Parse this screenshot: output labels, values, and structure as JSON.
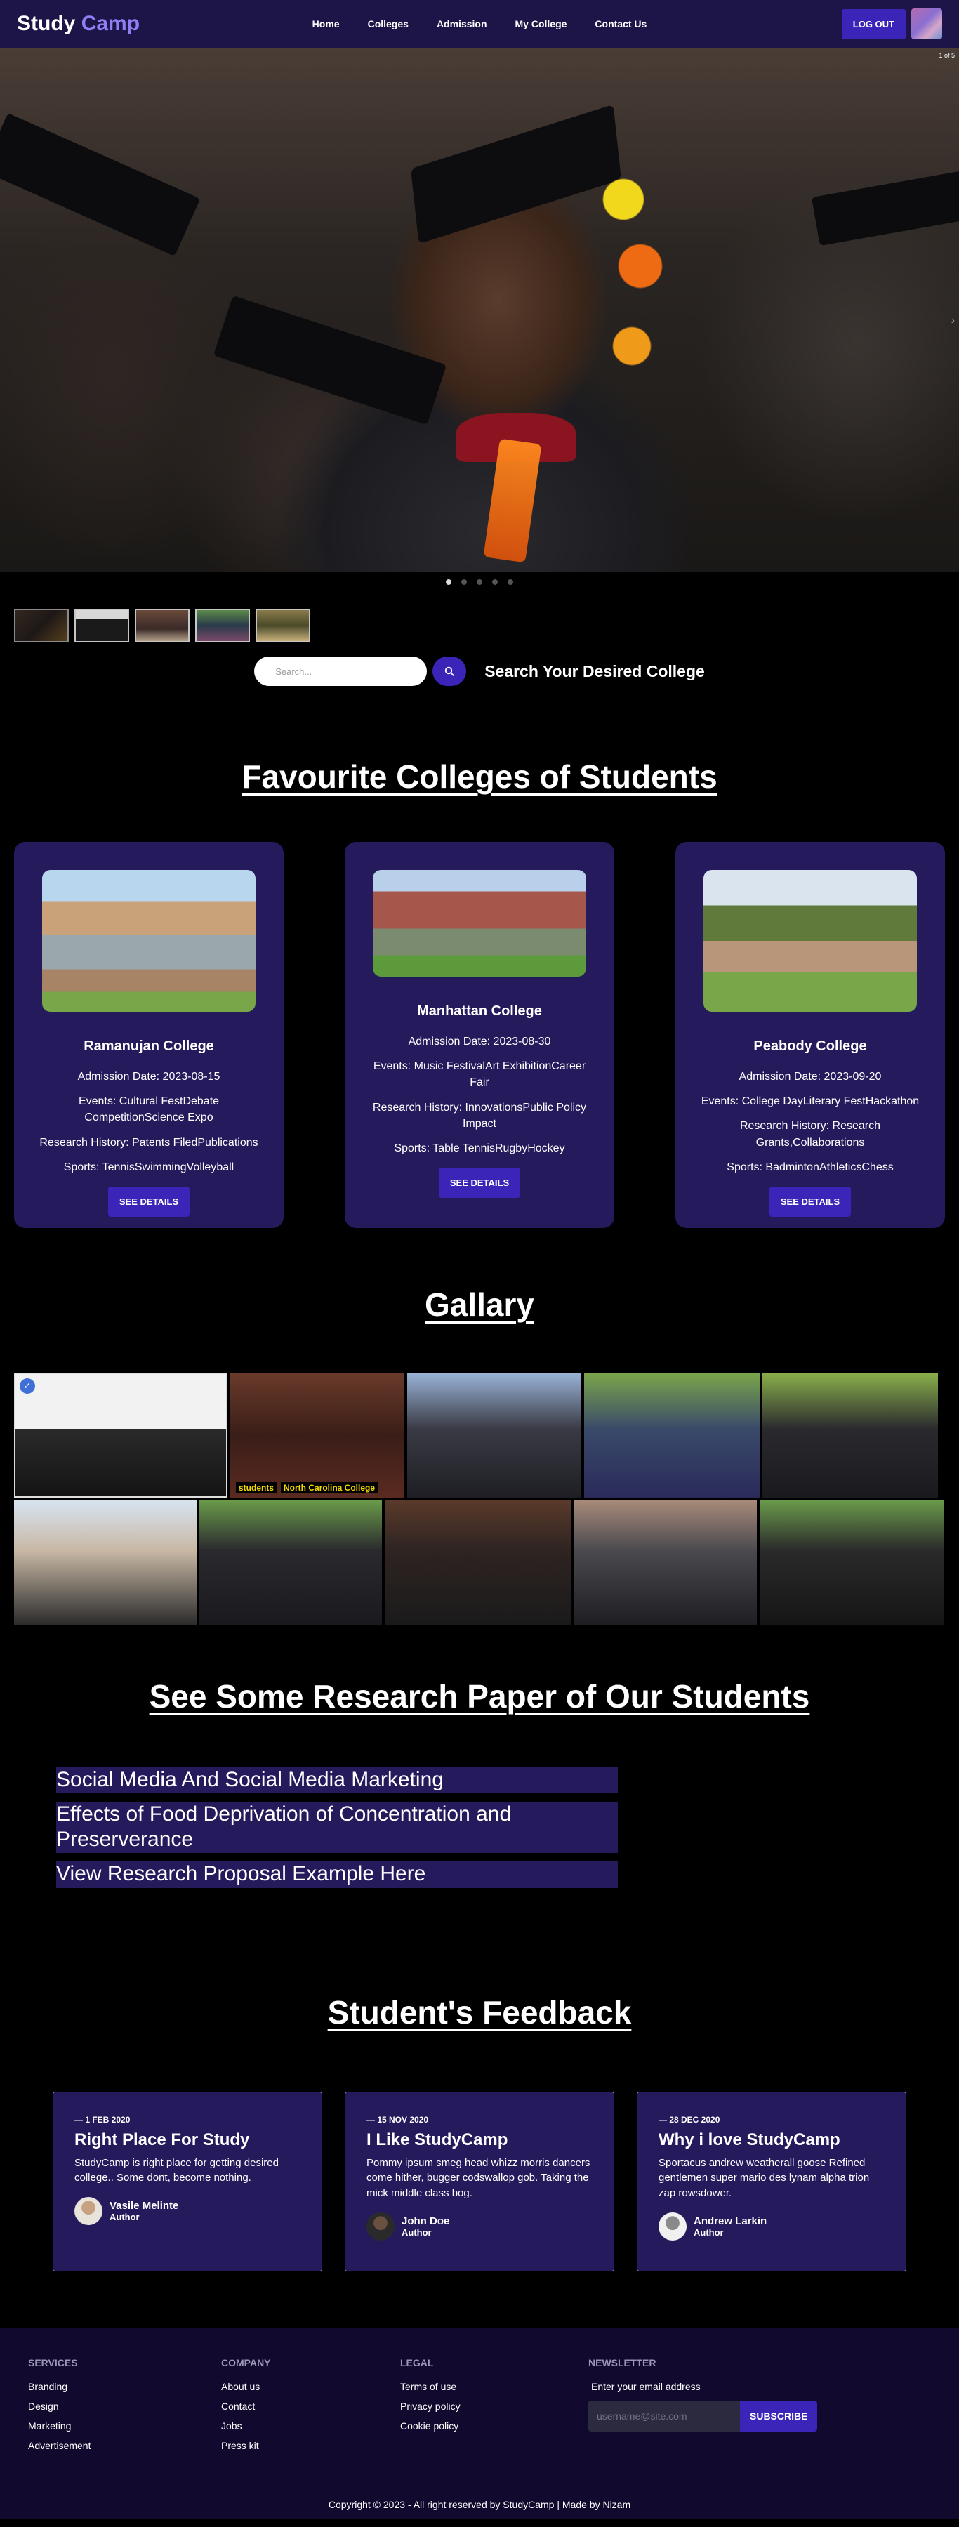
{
  "nav": {
    "brand_main": "Study",
    "brand_accent": "Camp",
    "links": [
      "Home",
      "Colleges",
      "Admission",
      "My College",
      "Contact Us"
    ],
    "logout": "LOG OUT"
  },
  "hero": {
    "counter": "1 of 5",
    "active_slide": 1,
    "slide_count": 5
  },
  "search": {
    "placeholder": "Search...",
    "heading": "Search Your Desired College"
  },
  "colleges_section": {
    "title": "Favourite Colleges of Students",
    "details_label": "SEE DETAILS",
    "items": [
      {
        "name": "Ramanujan College",
        "admission": "Admission Date: 2023-08-15",
        "events": "Events: Cultural FestDebate CompetitionScience Expo",
        "research": "Research History: Patents FiledPublications",
        "sports": "Sports: TennisSwimmingVolleyball"
      },
      {
        "name": "Manhattan College",
        "admission": "Admission Date: 2023-08-30",
        "events": "Events: Music FestivalArt ExhibitionCareer Fair",
        "research": "Research History: InnovationsPublic Policy Impact",
        "sports": "Sports: Table TennisRugbyHockey"
      },
      {
        "name": "Peabody College",
        "admission": "Admission Date: 2023-09-20",
        "events": "Events: College DayLiterary FestHackathon",
        "research": "Research History: Research Grants,Collaborations",
        "sports": "Sports: BadmintonAthleticsChess"
      }
    ]
  },
  "gallery": {
    "title": "Gallary",
    "banner_left": "students",
    "banner_right": "North Carolina College"
  },
  "papers": {
    "title": "See Some Research Paper of Our Students",
    "items": [
      "Social Media And Social Media Marketing",
      "Effects of Food Deprivation of Concentration and Preserverance",
      "View Research Proposal Example Here"
    ]
  },
  "feedback": {
    "title": "Student's Feedback",
    "items": [
      {
        "date": "— 1 FEB 2020",
        "title": "Right Place For Study",
        "text": "StudyCamp is right place for getting desired college.. Some dont, become nothing.",
        "name": "Vasile Melinte",
        "role": "Author"
      },
      {
        "date": "— 15 NOV 2020",
        "title": "I Like StudyCamp",
        "text": "Pommy ipsum smeg head whizz morris dancers come hither, bugger codswallop gob. Taking the mick middle class bog.",
        "name": "John Doe",
        "role": "Author"
      },
      {
        "date": "— 28 DEC 2020",
        "title": "Why i love StudyCamp",
        "text": "Sportacus andrew weatherall goose Refined gentlemen super mario des lynam alpha trion zap rowsdower.",
        "name": "Andrew Larkin",
        "role": "Author"
      }
    ]
  },
  "footer": {
    "services": {
      "heading": "SERVICES",
      "links": [
        "Branding",
        "Design",
        "Marketing",
        "Advertisement"
      ]
    },
    "company": {
      "heading": "COMPANY",
      "links": [
        "About us",
        "Contact",
        "Jobs",
        "Press kit"
      ]
    },
    "legal": {
      "heading": "LEGAL",
      "links": [
        "Terms of use",
        "Privacy policy",
        "Cookie policy"
      ]
    },
    "newsletter": {
      "heading": "NEWSLETTER",
      "label": "Enter your email address",
      "placeholder": "username@site.com",
      "button": "SUBSCRIBE"
    },
    "copyright": "Copyright © 2023 - All right reserved by StudyCamp | Made by Nizam"
  },
  "colors": {
    "navbar": "#1d1547",
    "accent": "#3b25b8",
    "brand_accent": "#8e7ff5",
    "card": "#241a5c",
    "footer": "#110a2e"
  }
}
